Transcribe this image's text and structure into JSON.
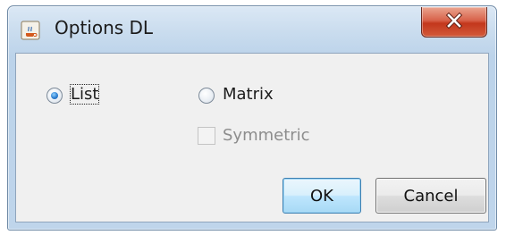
{
  "window": {
    "title": "Options DL",
    "app_icon": "java-cup-icon",
    "close_icon": "close-x-icon",
    "close_label": "X"
  },
  "options": {
    "list_label": "List",
    "list_selected": true,
    "matrix_label": "Matrix",
    "matrix_selected": false,
    "symmetric_label": "Symmetric",
    "symmetric_checked": false,
    "symmetric_enabled": false
  },
  "buttons": {
    "ok_label": "OK",
    "cancel_label": "Cancel"
  },
  "colors": {
    "close_button": "#c3371c",
    "selected_radio_dot": "#2f7fd0",
    "default_button_border": "#3c7fb1"
  }
}
